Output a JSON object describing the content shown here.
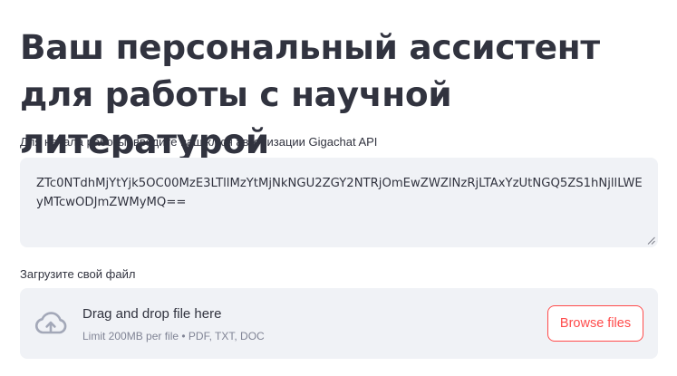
{
  "header": {
    "title": "Ваш персональный ассистент для работы с научной литературой"
  },
  "api_key": {
    "label": "Для начала работы, введите ваш ключ авторизации Gigachat API",
    "value": "ZTc0NTdhMjYtYjk5OC00MzE3LTllMzYtMjNkNGU2ZGY2NTRjOmEwZWZlNzRjLTAxYzUtNGQ5ZS1hNjllLWEyMTcwODJmZWMyMQ=="
  },
  "file_upload": {
    "label": "Загрузите свой файл",
    "drop_text": "Drag and drop file here",
    "limits_text": "Limit 200MB per file • PDF, TXT, DOC",
    "browse_label": "Browse files",
    "icon": "cloud-upload-icon"
  },
  "colors": {
    "accent": "#ff4b4b",
    "text": "#31333f",
    "muted": "#808495",
    "field_bg": "#f0f2f6"
  }
}
